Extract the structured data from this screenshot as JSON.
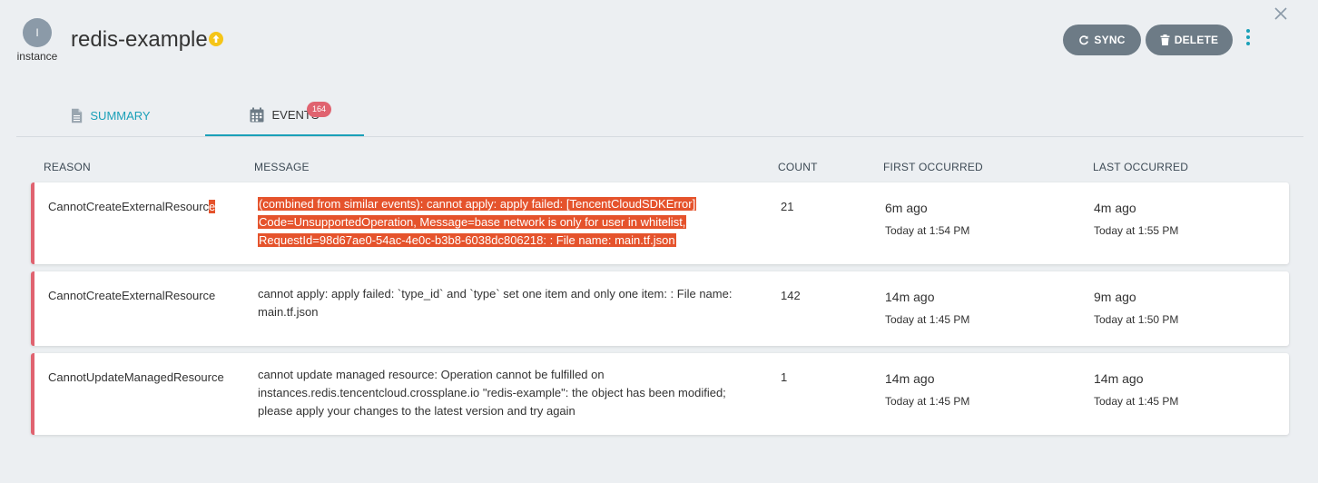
{
  "header": {
    "avatar_initial": "I",
    "avatar_label": "instance",
    "title": "redis-example",
    "status_icon": "arrow-up-circle-icon",
    "sync_label": "SYNC",
    "delete_label": "DELETE"
  },
  "tabs": [
    {
      "label": "SUMMARY",
      "icon": "document-icon",
      "active": false
    },
    {
      "label": "EVENTS",
      "icon": "calendar-icon",
      "active": true,
      "badge": "164"
    }
  ],
  "table": {
    "headers": [
      "REASON",
      "MESSAGE",
      "COUNT",
      "FIRST OCCURRED",
      "LAST OCCURRED"
    ],
    "rows": [
      {
        "reason": "CannotCreateExternalResource",
        "message_lines": [
          "(combined from similar events): cannot apply: apply failed: [TencentCloudSDKError]",
          "Code=UnsupportedOperation, Message=base network is only for user in whitelist,",
          "RequestId=98d67ae0-54ac-4e0c-b3b8-6038dc806218: : File name: main.tf.json"
        ],
        "count": "21",
        "first_ago": "6m ago",
        "first_time": "Today at 1:54 PM",
        "last_ago": "4m ago",
        "last_time": "Today at 1:55 PM"
      },
      {
        "reason": "CannotCreateExternalResource",
        "message_lines": [
          "cannot apply: apply failed: `type_id` and `type` set one item and only one item: : File name:",
          "main.tf.json"
        ],
        "count": "142",
        "first_ago": "14m ago",
        "first_time": "Today at 1:45 PM",
        "last_ago": "9m ago",
        "last_time": "Today at 1:50 PM"
      },
      {
        "reason": "CannotUpdateManagedResource",
        "message_lines": [
          "cannot update managed resource: Operation cannot be fulfilled on",
          "instances.redis.tencentcloud.crossplane.io \"redis-example\": the object has been modified;",
          "please apply your changes to the latest version and try again"
        ],
        "count": "1",
        "first_ago": "14m ago",
        "first_time": "Today at 1:45 PM",
        "last_ago": "14m ago",
        "last_time": "Today at 1:45 PM"
      }
    ]
  },
  "colors": {
    "accent": "#1aa0b8",
    "button": "#6d7b86",
    "error_stripe": "#e06370",
    "selection": "#e5532c",
    "warning": "#f5c518"
  }
}
